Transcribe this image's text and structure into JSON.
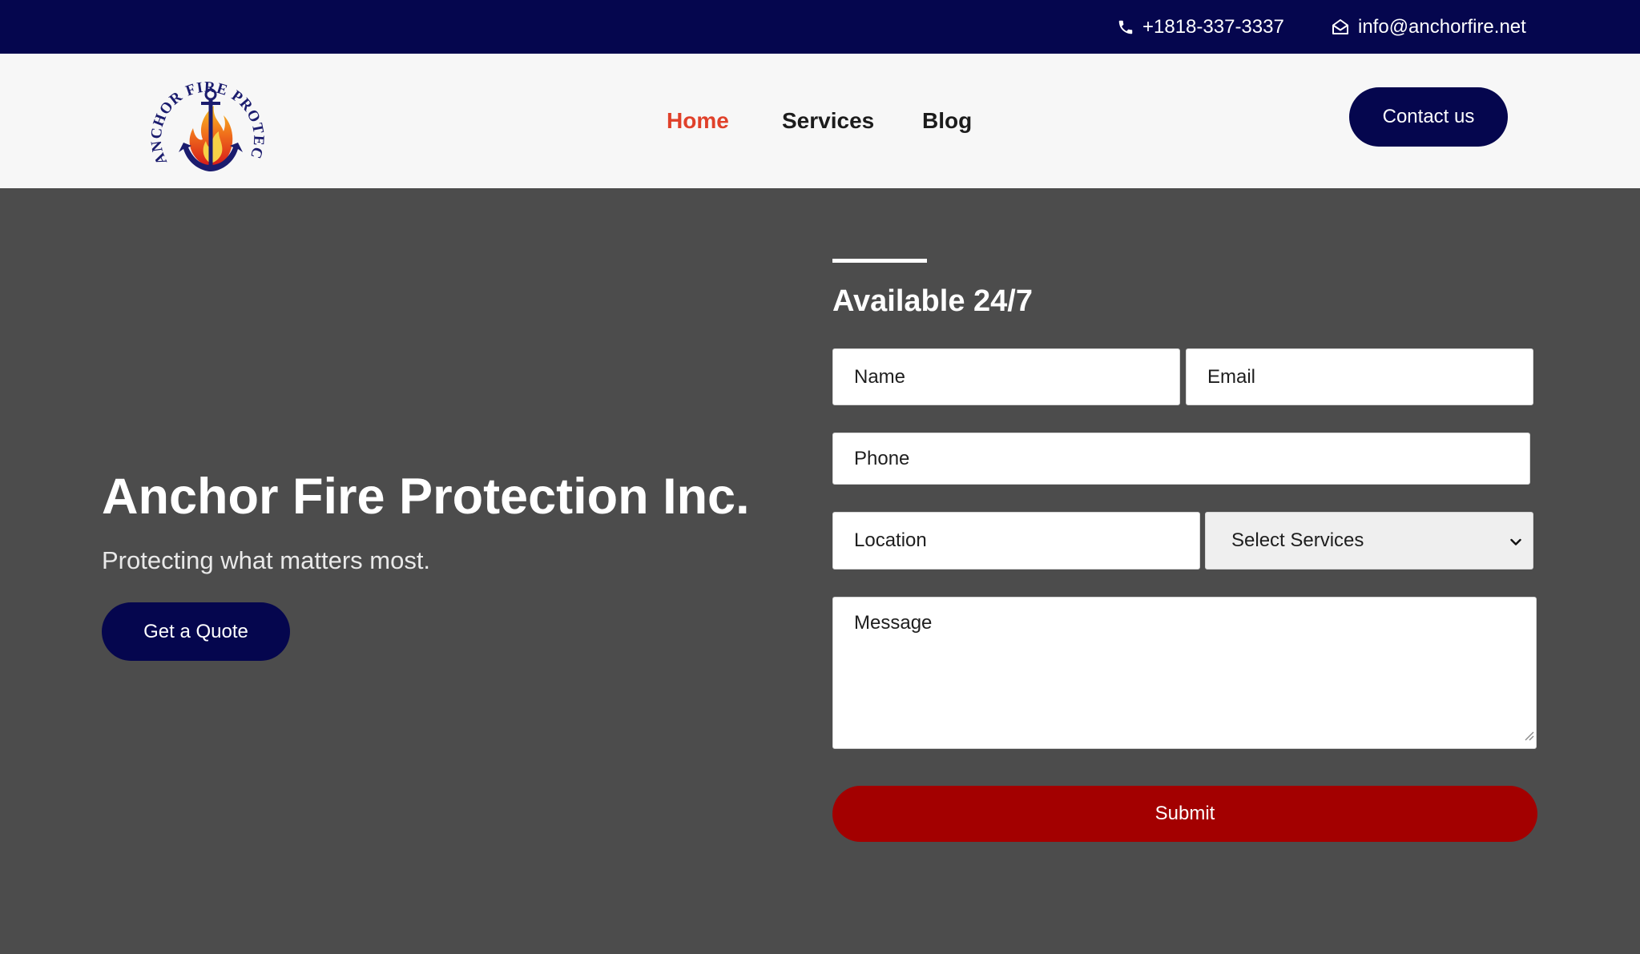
{
  "topbar": {
    "phone": "+1818-337-3337",
    "email": "info@anchorfire.net",
    "phone_icon": "phone-icon",
    "email_icon": "envelope-icon"
  },
  "header": {
    "logo_text": "ANCHOR FIRE PROTECTION INC.",
    "nav": [
      {
        "label": "Home",
        "active": true
      },
      {
        "label": "Services",
        "active": false
      },
      {
        "label": "Blog",
        "active": false
      }
    ],
    "contact_label": "Contact us"
  },
  "hero": {
    "title": "Anchor Fire Protection Inc.",
    "subtitle": "Protecting what matters most.",
    "quote_label": "Get a Quote"
  },
  "form": {
    "title": "Available 24/7",
    "name_placeholder": "Name",
    "email_placeholder": "Email",
    "phone_placeholder": "Phone",
    "location_placeholder": "Location",
    "services_selected": "Select Services",
    "message_placeholder": "Message",
    "submit_label": "Submit"
  },
  "colors": {
    "navy": "#05064e",
    "active_nav": "#e0412a",
    "submit_red": "#a30000",
    "hero_bg": "#4c4c4c"
  }
}
